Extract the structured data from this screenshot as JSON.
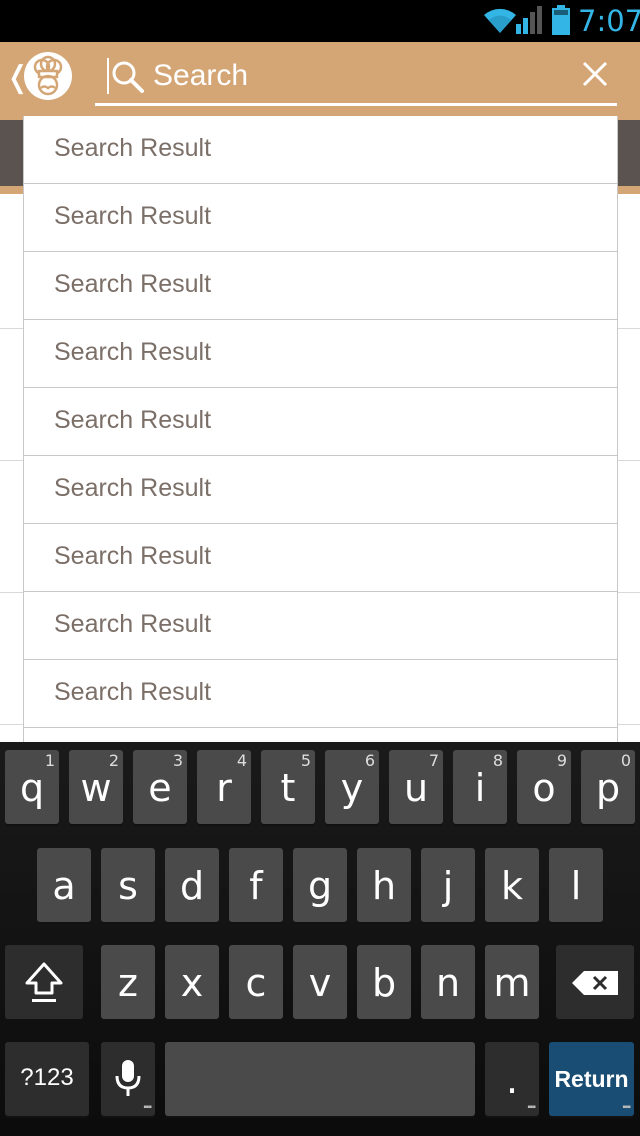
{
  "status_bar": {
    "time": "7:07",
    "accent_color": "#33b5e5"
  },
  "action_bar": {
    "background_color": "#d5a675",
    "back_glyph": "❬",
    "logo_icon": "chef-hat-logo-icon",
    "search_placeholder": "Search",
    "search_icon": "search-icon",
    "clear_icon": "close-icon"
  },
  "search_results": [
    "Search Result",
    "Search Result",
    "Search Result",
    "Search Result",
    "Search Result",
    "Search Result",
    "Search Result",
    "Search Result",
    "Search Result"
  ],
  "keyboard": {
    "row1": [
      {
        "ch": "q",
        "hint": "1"
      },
      {
        "ch": "w",
        "hint": "2"
      },
      {
        "ch": "e",
        "hint": "3"
      },
      {
        "ch": "r",
        "hint": "4"
      },
      {
        "ch": "t",
        "hint": "5"
      },
      {
        "ch": "y",
        "hint": "6"
      },
      {
        "ch": "u",
        "hint": "7"
      },
      {
        "ch": "i",
        "hint": "8"
      },
      {
        "ch": "o",
        "hint": "9"
      },
      {
        "ch": "p",
        "hint": "0"
      }
    ],
    "row2": [
      "a",
      "s",
      "d",
      "f",
      "g",
      "h",
      "j",
      "k",
      "l"
    ],
    "row3": [
      "z",
      "x",
      "c",
      "v",
      "b",
      "n",
      "m"
    ],
    "shift_icon": "shift-icon",
    "backspace_icon": "backspace-icon",
    "symbols_label": "?123",
    "mic_icon": "microphone-icon",
    "space_label": "",
    "period_label": ".",
    "return_label": "Return"
  }
}
